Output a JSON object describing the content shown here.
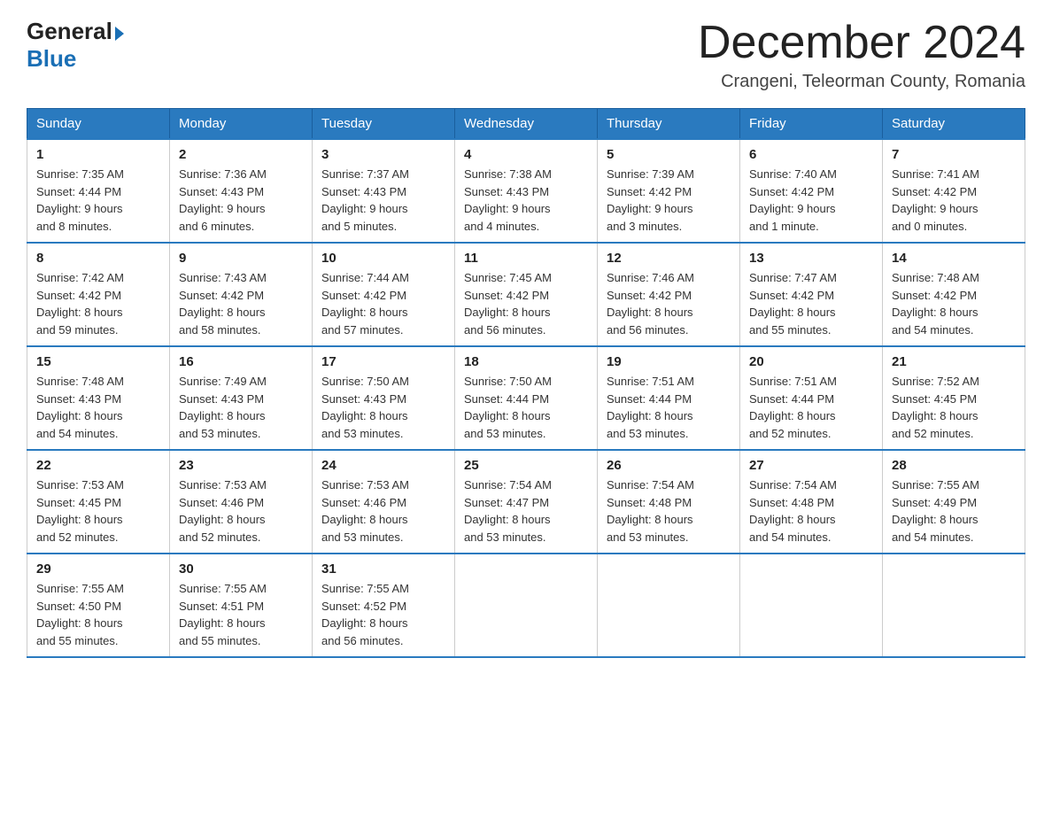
{
  "logo": {
    "general": "General",
    "blue": "Blue"
  },
  "title": "December 2024",
  "subtitle": "Crangeni, Teleorman County, Romania",
  "days_of_week": [
    "Sunday",
    "Monday",
    "Tuesday",
    "Wednesday",
    "Thursday",
    "Friday",
    "Saturday"
  ],
  "weeks": [
    [
      {
        "day": "1",
        "sunrise": "7:35 AM",
        "sunset": "4:44 PM",
        "daylight": "9 hours and 8 minutes."
      },
      {
        "day": "2",
        "sunrise": "7:36 AM",
        "sunset": "4:43 PM",
        "daylight": "9 hours and 6 minutes."
      },
      {
        "day": "3",
        "sunrise": "7:37 AM",
        "sunset": "4:43 PM",
        "daylight": "9 hours and 5 minutes."
      },
      {
        "day": "4",
        "sunrise": "7:38 AM",
        "sunset": "4:43 PM",
        "daylight": "9 hours and 4 minutes."
      },
      {
        "day": "5",
        "sunrise": "7:39 AM",
        "sunset": "4:42 PM",
        "daylight": "9 hours and 3 minutes."
      },
      {
        "day": "6",
        "sunrise": "7:40 AM",
        "sunset": "4:42 PM",
        "daylight": "9 hours and 1 minute."
      },
      {
        "day": "7",
        "sunrise": "7:41 AM",
        "sunset": "4:42 PM",
        "daylight": "9 hours and 0 minutes."
      }
    ],
    [
      {
        "day": "8",
        "sunrise": "7:42 AM",
        "sunset": "4:42 PM",
        "daylight": "8 hours and 59 minutes."
      },
      {
        "day": "9",
        "sunrise": "7:43 AM",
        "sunset": "4:42 PM",
        "daylight": "8 hours and 58 minutes."
      },
      {
        "day": "10",
        "sunrise": "7:44 AM",
        "sunset": "4:42 PM",
        "daylight": "8 hours and 57 minutes."
      },
      {
        "day": "11",
        "sunrise": "7:45 AM",
        "sunset": "4:42 PM",
        "daylight": "8 hours and 56 minutes."
      },
      {
        "day": "12",
        "sunrise": "7:46 AM",
        "sunset": "4:42 PM",
        "daylight": "8 hours and 56 minutes."
      },
      {
        "day": "13",
        "sunrise": "7:47 AM",
        "sunset": "4:42 PM",
        "daylight": "8 hours and 55 minutes."
      },
      {
        "day": "14",
        "sunrise": "7:48 AM",
        "sunset": "4:42 PM",
        "daylight": "8 hours and 54 minutes."
      }
    ],
    [
      {
        "day": "15",
        "sunrise": "7:48 AM",
        "sunset": "4:43 PM",
        "daylight": "8 hours and 54 minutes."
      },
      {
        "day": "16",
        "sunrise": "7:49 AM",
        "sunset": "4:43 PM",
        "daylight": "8 hours and 53 minutes."
      },
      {
        "day": "17",
        "sunrise": "7:50 AM",
        "sunset": "4:43 PM",
        "daylight": "8 hours and 53 minutes."
      },
      {
        "day": "18",
        "sunrise": "7:50 AM",
        "sunset": "4:44 PM",
        "daylight": "8 hours and 53 minutes."
      },
      {
        "day": "19",
        "sunrise": "7:51 AM",
        "sunset": "4:44 PM",
        "daylight": "8 hours and 53 minutes."
      },
      {
        "day": "20",
        "sunrise": "7:51 AM",
        "sunset": "4:44 PM",
        "daylight": "8 hours and 52 minutes."
      },
      {
        "day": "21",
        "sunrise": "7:52 AM",
        "sunset": "4:45 PM",
        "daylight": "8 hours and 52 minutes."
      }
    ],
    [
      {
        "day": "22",
        "sunrise": "7:53 AM",
        "sunset": "4:45 PM",
        "daylight": "8 hours and 52 minutes."
      },
      {
        "day": "23",
        "sunrise": "7:53 AM",
        "sunset": "4:46 PM",
        "daylight": "8 hours and 52 minutes."
      },
      {
        "day": "24",
        "sunrise": "7:53 AM",
        "sunset": "4:46 PM",
        "daylight": "8 hours and 53 minutes."
      },
      {
        "day": "25",
        "sunrise": "7:54 AM",
        "sunset": "4:47 PM",
        "daylight": "8 hours and 53 minutes."
      },
      {
        "day": "26",
        "sunrise": "7:54 AM",
        "sunset": "4:48 PM",
        "daylight": "8 hours and 53 minutes."
      },
      {
        "day": "27",
        "sunrise": "7:54 AM",
        "sunset": "4:48 PM",
        "daylight": "8 hours and 54 minutes."
      },
      {
        "day": "28",
        "sunrise": "7:55 AM",
        "sunset": "4:49 PM",
        "daylight": "8 hours and 54 minutes."
      }
    ],
    [
      {
        "day": "29",
        "sunrise": "7:55 AM",
        "sunset": "4:50 PM",
        "daylight": "8 hours and 55 minutes."
      },
      {
        "day": "30",
        "sunrise": "7:55 AM",
        "sunset": "4:51 PM",
        "daylight": "8 hours and 55 minutes."
      },
      {
        "day": "31",
        "sunrise": "7:55 AM",
        "sunset": "4:52 PM",
        "daylight": "8 hours and 56 minutes."
      },
      null,
      null,
      null,
      null
    ]
  ],
  "labels": {
    "sunrise": "Sunrise:",
    "sunset": "Sunset:",
    "daylight": "Daylight:"
  }
}
